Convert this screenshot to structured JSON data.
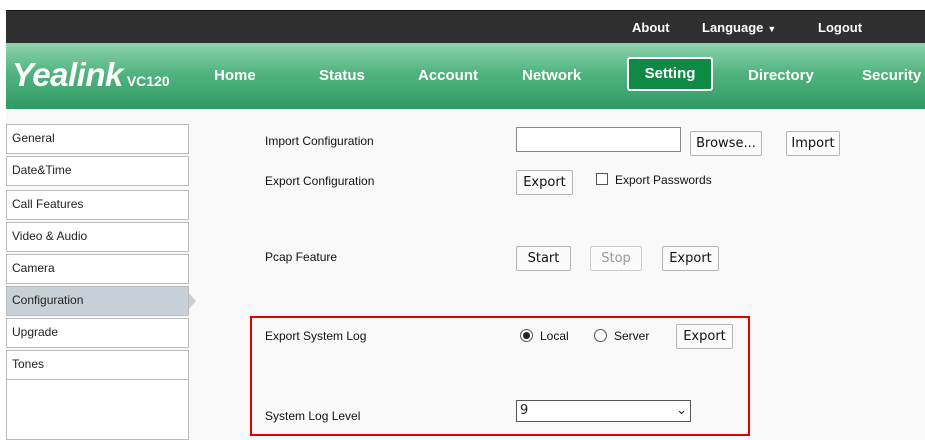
{
  "topbar": {
    "about": "About",
    "language": "Language",
    "logout": "Logout"
  },
  "brand": {
    "name": "Yealink",
    "model": "VC120"
  },
  "nav": {
    "home": "Home",
    "status": "Status",
    "account": "Account",
    "network": "Network",
    "setting": "Setting",
    "directory": "Directory",
    "security": "Security",
    "active": "Setting"
  },
  "sidebar": {
    "items": [
      {
        "label": "General"
      },
      {
        "label": "Date&Time"
      },
      {
        "label": "Call Features"
      },
      {
        "label": "Video & Audio"
      },
      {
        "label": "Camera"
      },
      {
        "label": "Configuration"
      },
      {
        "label": "Upgrade"
      },
      {
        "label": "Tones"
      }
    ],
    "active": "Configuration"
  },
  "config": {
    "import_label": "Import Configuration",
    "import_value": "",
    "browse": "Browse...",
    "import": "Import",
    "export_label": "Export Configuration",
    "export": "Export",
    "export_passwords": "Export Passwords",
    "export_passwords_checked": false,
    "pcap_label": "Pcap Feature",
    "start": "Start",
    "stop": "Stop",
    "pcap_export": "Export",
    "syslog_label": "Export System Log",
    "local": "Local",
    "server": "Server",
    "log_export": "Export",
    "log_target": "Local",
    "loglevel_label": "System Log Level",
    "loglevel_value": "9"
  },
  "colors": {
    "topbar": "#2f2f2f",
    "nav_green": "#52b480",
    "nav_active": "#0e8a45",
    "highlight": "#e00000",
    "sidebar_active": "#c8d0d8"
  }
}
